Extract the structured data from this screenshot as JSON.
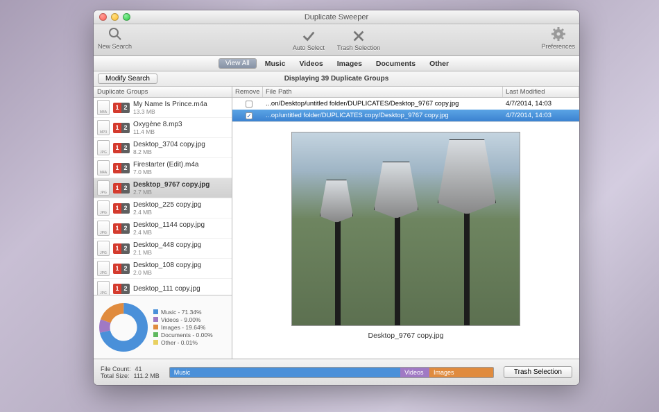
{
  "window": {
    "title": "Duplicate Sweeper"
  },
  "toolbar": {
    "new_search": "New Search",
    "auto_select": "Auto Select",
    "trash_selection": "Trash Selection",
    "preferences": "Preferences"
  },
  "tabs": {
    "view_all": "View All",
    "music": "Music",
    "videos": "Videos",
    "images": "Images",
    "documents": "Documents",
    "other": "Other"
  },
  "subbar": {
    "modify": "Modify Search",
    "displaying": "Displaying 39 Duplicate Groups"
  },
  "sidebar": {
    "header": "Duplicate Groups",
    "items": [
      {
        "name": "My Name Is Prince.m4a",
        "size": "13.3 MB",
        "ext": "M4A"
      },
      {
        "name": "Oxygène 8.mp3",
        "size": "11.4 MB",
        "ext": "MP3"
      },
      {
        "name": "Desktop_3704 copy.jpg",
        "size": "8.2 MB",
        "ext": "JPG"
      },
      {
        "name": "Firestarter (Edit).m4a",
        "size": "7.0 MB",
        "ext": "M4A"
      },
      {
        "name": "Desktop_9767 copy.jpg",
        "size": "2.7 MB",
        "ext": "JPG"
      },
      {
        "name": "Desktop_225 copy.jpg",
        "size": "2.4 MB",
        "ext": "JPG"
      },
      {
        "name": "Desktop_1144 copy.jpg",
        "size": "2.4 MB",
        "ext": "JPG"
      },
      {
        "name": "Desktop_448 copy.jpg",
        "size": "2.1 MB",
        "ext": "JPG"
      },
      {
        "name": "Desktop_108 copy.jpg",
        "size": "2.0 MB",
        "ext": "JPG"
      },
      {
        "name": "Desktop_111 copy.jpg",
        "size": "",
        "ext": "JPG"
      }
    ]
  },
  "chart_data": {
    "type": "pie",
    "series": [
      {
        "name": "Music",
        "value": 71.34,
        "color": "#4a90d9"
      },
      {
        "name": "Videos",
        "value": 9.0,
        "color": "#a079c4"
      },
      {
        "name": "Images",
        "value": 19.64,
        "color": "#e08b3e"
      },
      {
        "name": "Documents",
        "value": 0.0,
        "color": "#5fb85f"
      },
      {
        "name": "Other",
        "value": 0.01,
        "color": "#e8d060"
      }
    ],
    "legend_pct": [
      "71.34%",
      "9.00%",
      "19.64%",
      "0.00%",
      "0.01%"
    ]
  },
  "detail": {
    "headers": {
      "remove": "Remove",
      "filepath": "File Path",
      "modified": "Last Modified"
    },
    "rows": [
      {
        "checked": false,
        "path": "...on/Desktop/untitled folder/DUPLICATES/Desktop_9767 copy.jpg",
        "modified": "4/7/2014, 14:03"
      },
      {
        "checked": true,
        "path": "...op/untitled folder/DUPLICATES copy/Desktop_9767 copy.jpg",
        "modified": "4/7/2014, 14:03"
      }
    ],
    "preview_caption": "Desktop_9767 copy.jpg"
  },
  "footer": {
    "filecount_lbl": "File Count:",
    "filecount": "41",
    "totalsize_lbl": "Total Size:",
    "totalsize": "111.2 MB",
    "bar": {
      "music": "Music",
      "videos": "Videos",
      "images": "Images"
    },
    "trash": "Trash Selection"
  }
}
